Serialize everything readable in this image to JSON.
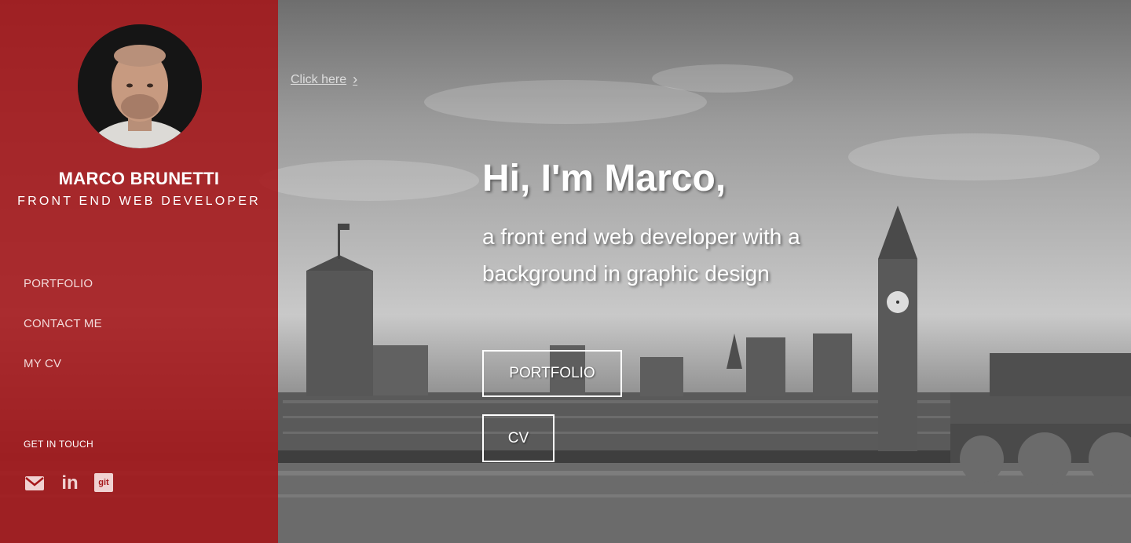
{
  "sidebar": {
    "name": "MARCO BRUNETTI",
    "role": "FRONT END WEB DEVELOPER",
    "nav": [
      {
        "label": "PORTFOLIO"
      },
      {
        "label": "CONTACT ME"
      },
      {
        "label": "MY CV"
      }
    ],
    "get_in_touch": "GET IN TOUCH",
    "social": [
      {
        "icon": "email-icon"
      },
      {
        "icon": "linkedin-icon",
        "label": "in"
      },
      {
        "icon": "git-icon",
        "label": "git"
      }
    ]
  },
  "hero": {
    "click_here": "Click here",
    "chevron": "›",
    "headline": "Hi, I'm Marco,",
    "subline": "a front end web developer with a background in graphic design",
    "buttons": [
      {
        "label": "PORTFOLIO"
      },
      {
        "label": "CV"
      }
    ]
  },
  "colors": {
    "sidebar_bg": "#a51619",
    "text": "#ffffff"
  }
}
